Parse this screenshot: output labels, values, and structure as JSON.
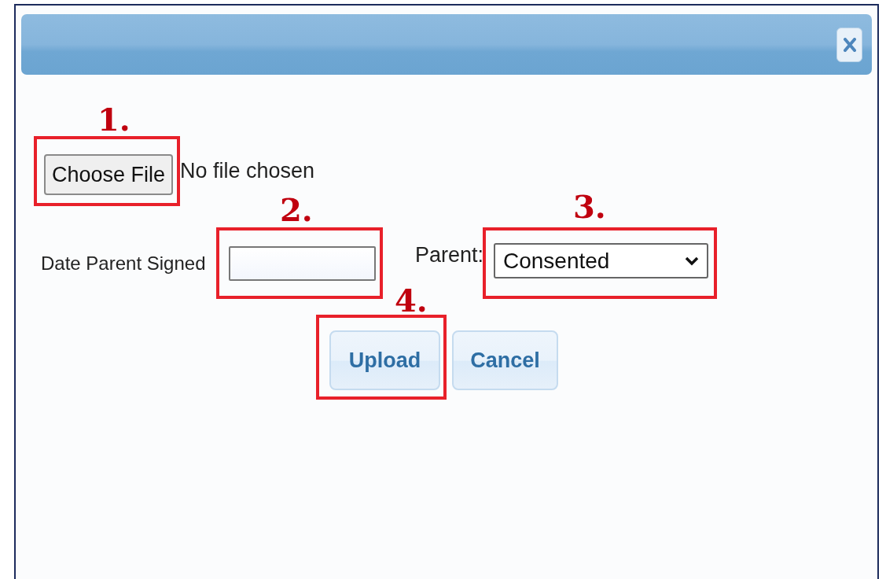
{
  "file_picker": {
    "button": "Choose File",
    "status": "No file chosen",
    "step": "1."
  },
  "date_field": {
    "label": "Date Parent Signed",
    "step": "2."
  },
  "parent_field": {
    "label": "Parent:",
    "value": "Consented",
    "step": "3."
  },
  "buttons": [
    {
      "label": "Upload",
      "step": "4."
    },
    {
      "label": "Cancel"
    }
  ]
}
